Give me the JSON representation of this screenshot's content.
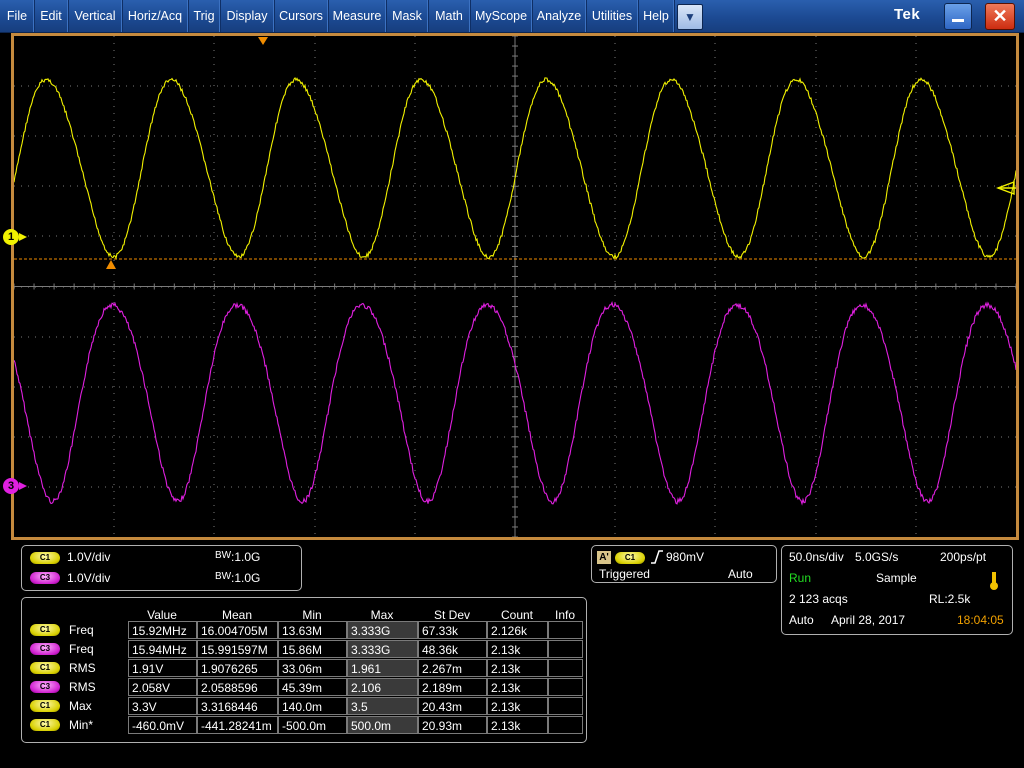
{
  "menu": [
    "File",
    "Edit",
    "Vertical",
    "Horiz/Acq",
    "Trig",
    "Display",
    "Cursors",
    "Measure",
    "Mask",
    "Math",
    "MyScope",
    "Analyze",
    "Utilities",
    "Help"
  ],
  "dropdown_glyph": "▼",
  "brand": "Tek",
  "window_controls": {
    "minimize_icon": "minimize-icon",
    "close_glyph": "✕"
  },
  "markers": {
    "ch1": "1",
    "ch3": "3"
  },
  "colors": {
    "ch1": "#f2f200",
    "ch3": "#e020e0",
    "trigger": "#f08c00",
    "grid": "#7a7a7a",
    "frame": "#c58a3e"
  },
  "channels": [
    {
      "badge": "C1",
      "scale": "1.0V/div",
      "bw_label": "BW",
      "bw_value": ":1.0G"
    },
    {
      "badge": "C3",
      "scale": "1.0V/div",
      "bw_label": "BW",
      "bw_value": ":1.0G"
    }
  ],
  "trigger": {
    "a_badge": "A'",
    "source": "C1",
    "level": "980mV",
    "status": "Triggered",
    "mode": "Auto"
  },
  "acquisition": {
    "timebase": "50.0ns/div",
    "sample_rate": "5.0GS/s",
    "resolution": "200ps/pt",
    "state": "Run",
    "mode": "Sample",
    "acqs": "2 123 acqs",
    "record_length": "RL:2.5k",
    "trigger_mode": "Auto",
    "date": "April 28, 2017",
    "time": "18:04:05"
  },
  "measurements": {
    "headers": [
      "Value",
      "Mean",
      "Min",
      "Max",
      "St Dev",
      "Count",
      "Info"
    ],
    "rows": [
      {
        "ch": "C1",
        "name": "Freq",
        "value": "15.92MHz",
        "mean": "16.004705M",
        "min": "13.63M",
        "max": "3.333G",
        "stdev": "67.33k",
        "count": "2.126k",
        "info": ""
      },
      {
        "ch": "C3",
        "name": "Freq",
        "value": "15.94MHz",
        "mean": "15.991597M",
        "min": "15.86M",
        "max": "3.333G",
        "stdev": "48.36k",
        "count": "2.13k",
        "info": ""
      },
      {
        "ch": "C1",
        "name": "RMS",
        "value": "1.91V",
        "mean": "1.9076265",
        "min": "33.06m",
        "max": "1.961",
        "stdev": "2.267m",
        "count": "2.13k",
        "info": ""
      },
      {
        "ch": "C3",
        "name": "RMS",
        "value": "2.058V",
        "mean": "2.0588596",
        "min": "45.39m",
        "max": "2.106",
        "stdev": "2.189m",
        "count": "2.13k",
        "info": ""
      },
      {
        "ch": "C1",
        "name": "Max",
        "value": "3.3V",
        "mean": "3.3168446",
        "min": "140.0m",
        "max": "3.5",
        "stdev": "20.43m",
        "count": "2.13k",
        "info": ""
      },
      {
        "ch": "C1",
        "name": "Min*",
        "value": "-460.0mV",
        "mean": "-441.28241m",
        "min": "-500.0m",
        "max": "500.0m",
        "stdev": "20.93m",
        "count": "2.13k",
        "info": ""
      }
    ]
  }
}
